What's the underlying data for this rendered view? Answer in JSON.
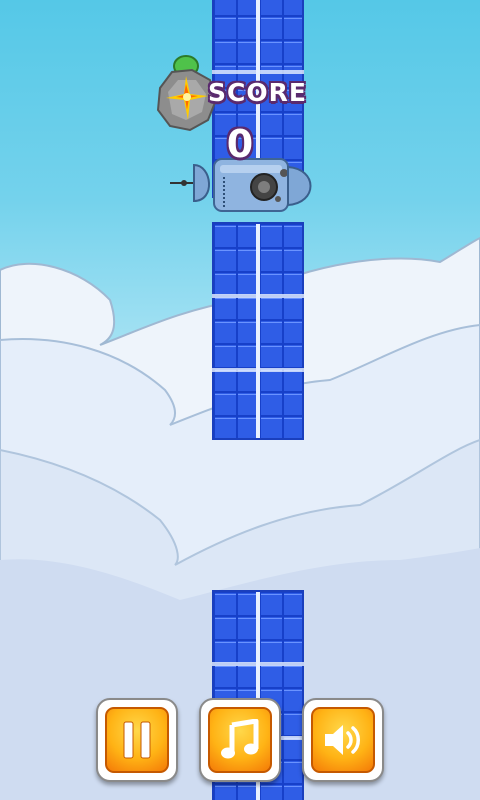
{
  "hud": {
    "score_label": "SCORE",
    "score_value": "0"
  },
  "controls": {
    "pause_icon": "pause-icon",
    "music_icon": "music-note-icon",
    "sound_icon": "speaker-icon"
  },
  "colors": {
    "sky": "#55c8e7",
    "pipe": "#2f5de6",
    "button": "#ffb315",
    "score_outline": "#5a2a6e"
  }
}
